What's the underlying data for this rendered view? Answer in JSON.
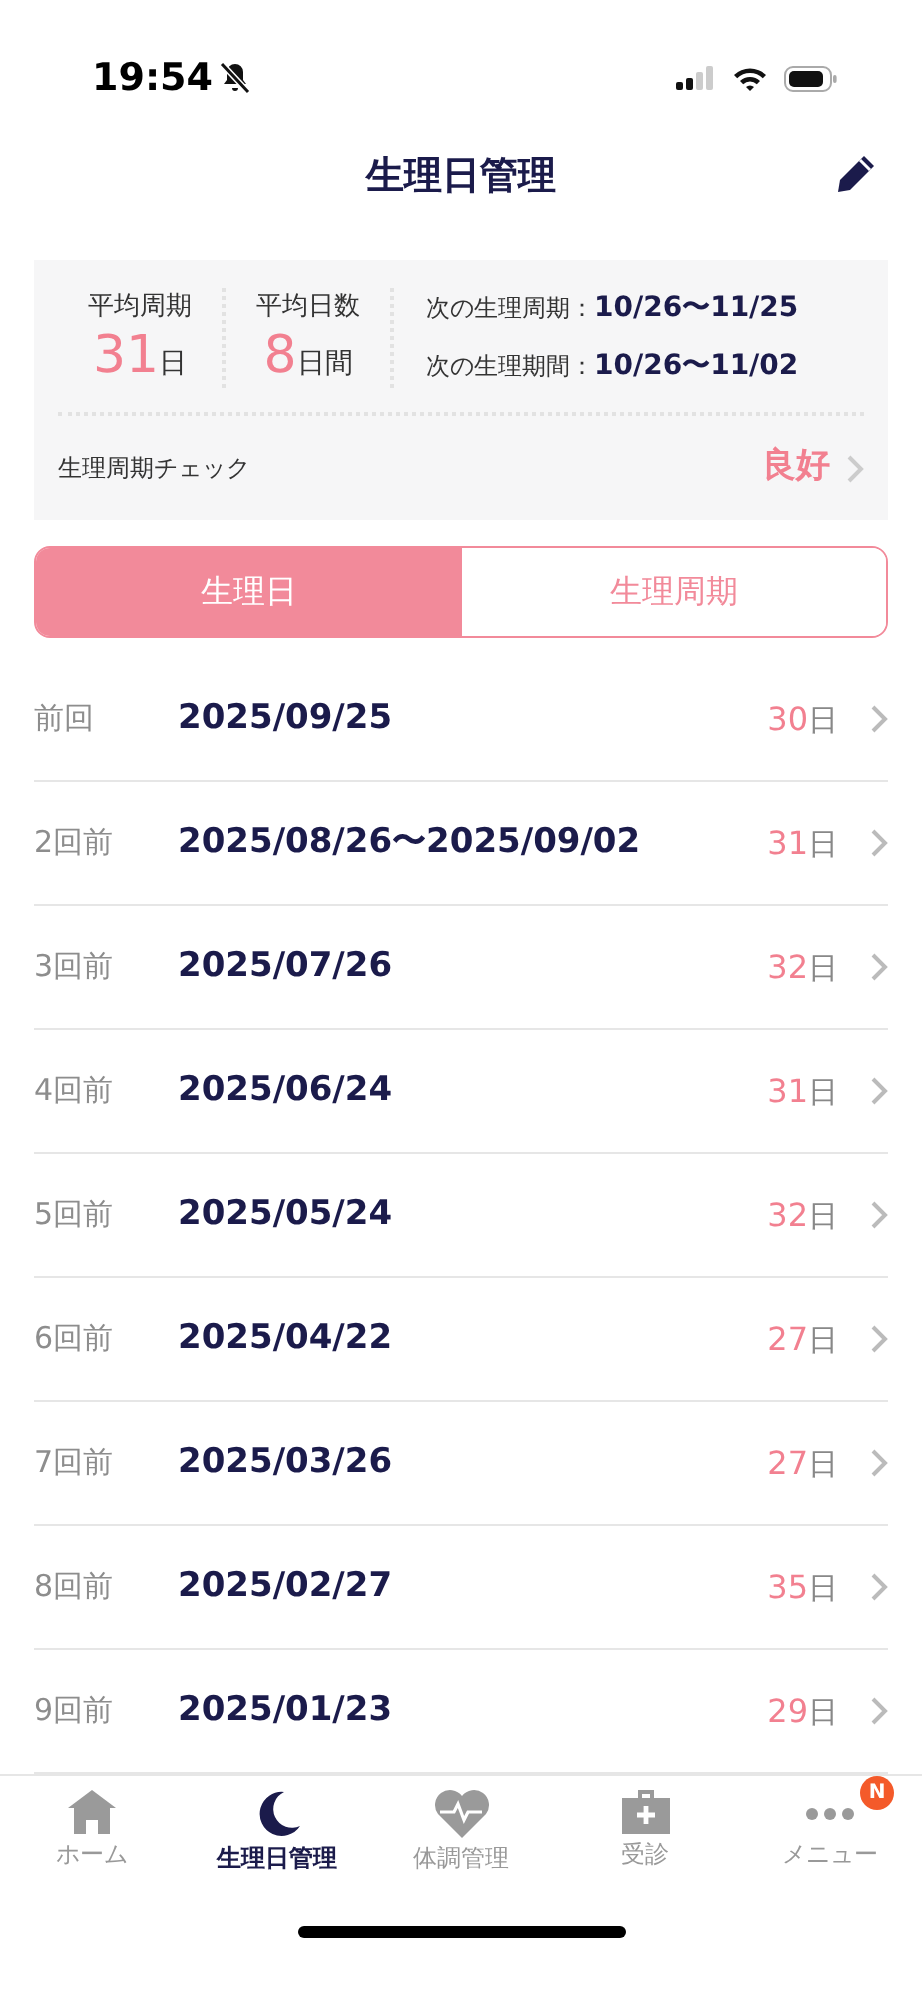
{
  "status_bar": {
    "time": "19:54"
  },
  "header": {
    "title": "生理日管理"
  },
  "summary": {
    "stats": [
      {
        "label": "平均周期",
        "value": "31",
        "unit": "日"
      },
      {
        "label": "平均日数",
        "value": "8",
        "unit": "日間"
      }
    ],
    "next": [
      {
        "label": "次の生理周期：",
        "value": "10/26〜11/25"
      },
      {
        "label": "次の生理期間：",
        "value": "10/26〜11/02"
      }
    ],
    "check": {
      "label": "生理周期チェック",
      "value": "良好"
    }
  },
  "segments": [
    {
      "label": "生理日",
      "selected": true
    },
    {
      "label": "生理周期",
      "selected": false
    }
  ],
  "records": [
    {
      "label": "前回",
      "date": "2025/09/25",
      "days": "30",
      "unit": "日"
    },
    {
      "label": "2回前",
      "date": "2025/08/26〜2025/09/02",
      "days": "31",
      "unit": "日"
    },
    {
      "label": "3回前",
      "date": "2025/07/26",
      "days": "32",
      "unit": "日"
    },
    {
      "label": "4回前",
      "date": "2025/06/24",
      "days": "31",
      "unit": "日"
    },
    {
      "label": "5回前",
      "date": "2025/05/24",
      "days": "32",
      "unit": "日"
    },
    {
      "label": "6回前",
      "date": "2025/04/22",
      "days": "27",
      "unit": "日"
    },
    {
      "label": "7回前",
      "date": "2025/03/26",
      "days": "27",
      "unit": "日"
    },
    {
      "label": "8回前",
      "date": "2025/02/27",
      "days": "35",
      "unit": "日"
    },
    {
      "label": "9回前",
      "date": "2025/01/23",
      "days": "29",
      "unit": "日"
    }
  ],
  "tabs": [
    {
      "label": "ホーム",
      "selected": false
    },
    {
      "label": "生理日管理",
      "selected": true
    },
    {
      "label": "体調管理",
      "selected": false
    },
    {
      "label": "受診",
      "selected": false
    },
    {
      "label": "メニュー",
      "selected": false,
      "badge": "N"
    }
  ]
}
